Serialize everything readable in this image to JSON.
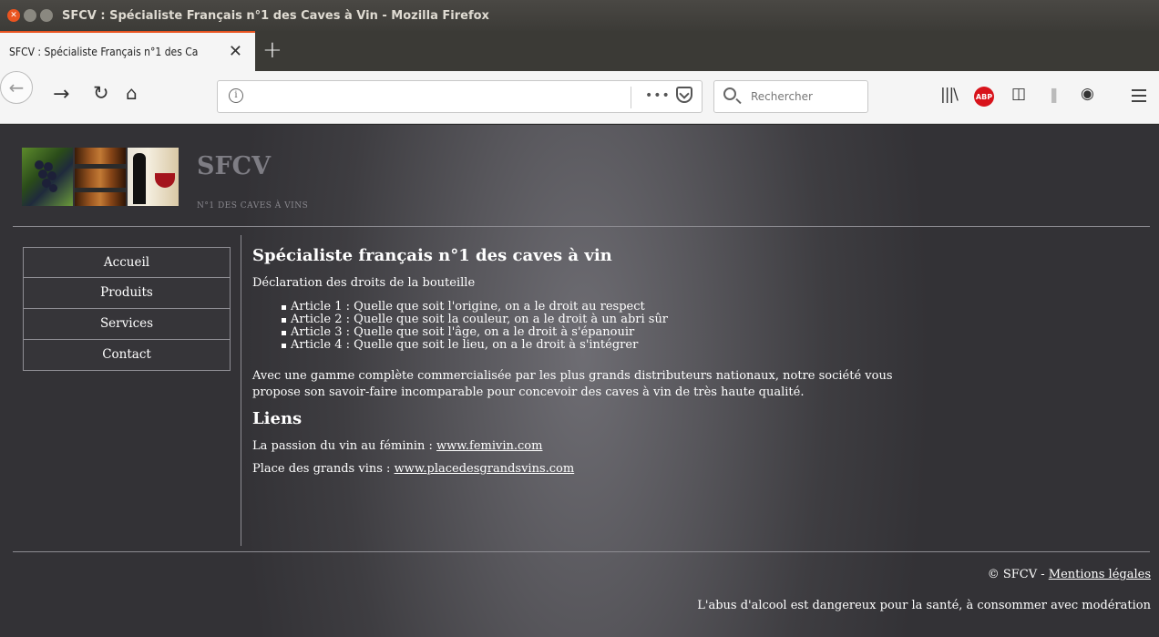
{
  "window": {
    "title": "SFCV : Spécialiste Français n°1 des Caves à Vin - Mozilla Firefox"
  },
  "tab": {
    "label": "SFCV : Spécialiste Français n°1 des Ca"
  },
  "navbar": {
    "search_placeholder": "Rechercher"
  },
  "site": {
    "title": "SFCV",
    "tagline": "N°1 DES CAVES À VINS"
  },
  "sidebar": {
    "items": [
      {
        "label": "Accueil"
      },
      {
        "label": "Produits"
      },
      {
        "label": "Services"
      },
      {
        "label": "Contact"
      }
    ]
  },
  "main": {
    "heading": "Spécialiste français n°1 des caves à vin",
    "intro": "Déclaration des droits de la bouteille",
    "articles": [
      "Article 1 : Quelle que soit l'origine, on a le droit au respect",
      "Article 2 : Quelle que soit la couleur, on a le droit à un abri sûr",
      "Article 3 : Quelle que soit l'âge, on a le droit à s'épanouir",
      "Article 4 : Quelle que soit le lieu, on a le droit à s'intégrer"
    ],
    "description_line1": "Avec une gamme complète commercialisée par les plus grands distributeurs nationaux, notre société vous",
    "description_line2": "propose son savoir-faire incomparable pour concevoir des caves à vin de très haute qualité.",
    "links_heading": "Liens",
    "links": [
      {
        "prefix": "La passion du vin au féminin : ",
        "text": "www.femivin.com"
      },
      {
        "prefix": "Place des grands vins : ",
        "text": "www.placedesgrandsvins.com"
      }
    ]
  },
  "footer": {
    "copyright": "© SFCV - ",
    "legal_link": "Mentions légales",
    "warning": "L'abus d'alcool est dangereux pour la santé, à consommer avec modération"
  }
}
